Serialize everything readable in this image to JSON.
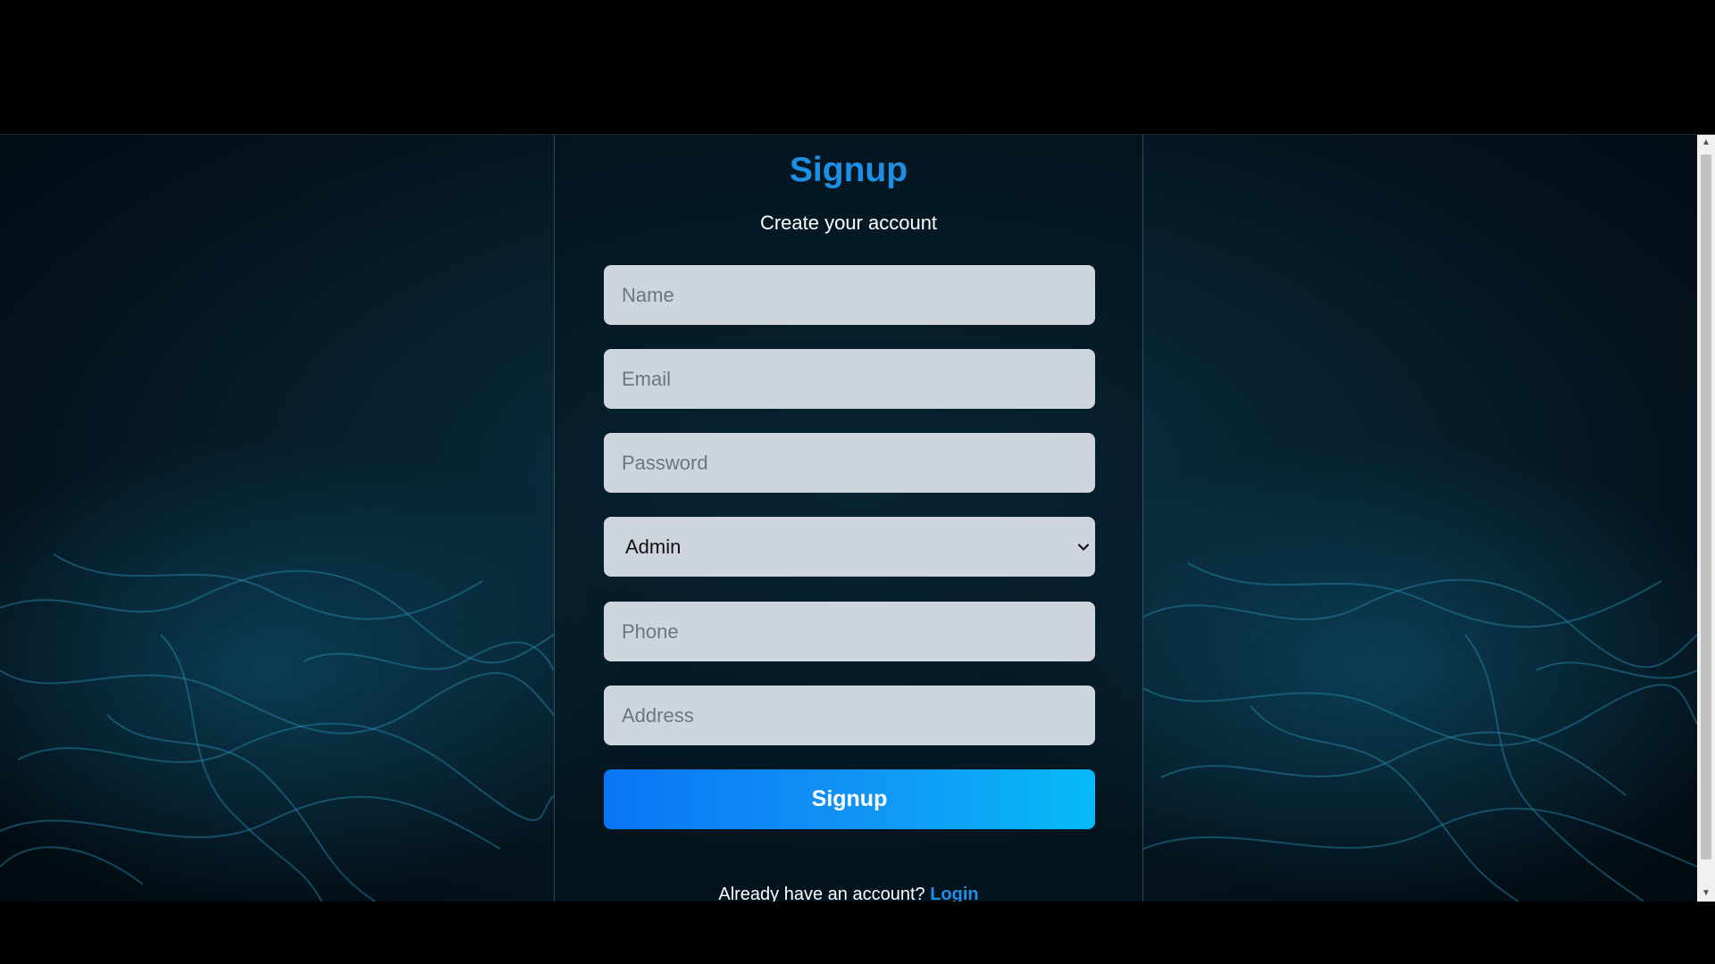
{
  "form": {
    "title": "Signup",
    "subtitle": "Create your account",
    "name_placeholder": "Name",
    "email_placeholder": "Email",
    "password_placeholder": "Password",
    "role_options": [
      "Admin"
    ],
    "role_selected": "Admin",
    "phone_placeholder": "Phone",
    "address_placeholder": "Address",
    "submit_label": "Signup"
  },
  "footer": {
    "prompt": "Already have an account?",
    "login_link": "Login"
  },
  "icons": {
    "select_chevron": "chevron-down-icon",
    "scroll_up": "scroll-up-arrow-icon",
    "scroll_down": "scroll-down-arrow-icon"
  },
  "colors": {
    "accent": "#1f8fe6",
    "button_gradient_start": "#0a75f5",
    "button_gradient_end": "#07baf7",
    "field_background": "#cfd5dc"
  }
}
